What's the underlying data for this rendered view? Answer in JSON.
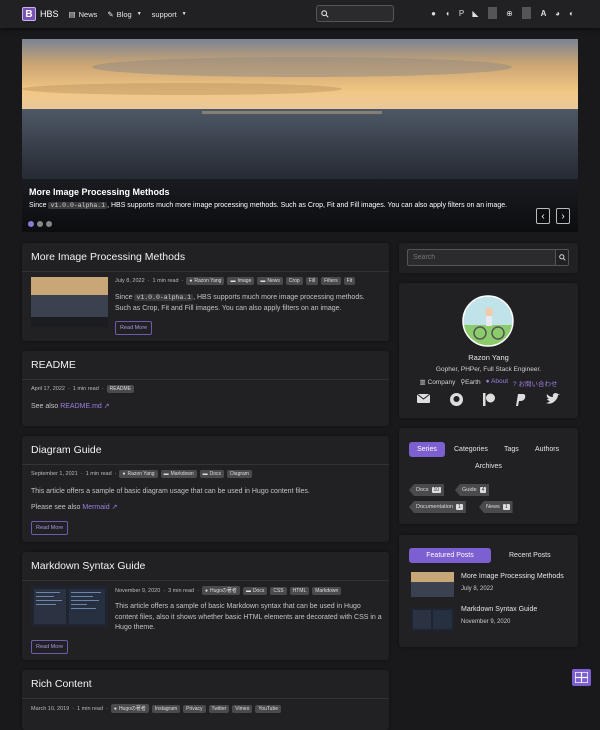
{
  "nav": {
    "brand": "HBS",
    "links": [
      {
        "label": "News",
        "icon": "newspaper-icon"
      },
      {
        "label": "Blog",
        "icon": "blog-icon"
      },
      {
        "label": "support",
        "icon": ""
      }
    ],
    "icons": [
      "github-icon",
      "patreon-icon",
      "paypal-icon",
      "rss-icon",
      "language-icon",
      "font-size-icon",
      "palette-icon",
      "theme-toggle-icon"
    ]
  },
  "hero": {
    "title": "More Image Processing Methods",
    "text_before": "Since ",
    "code": "v1.0.0-alpha.1",
    "text_after": ", HBS supports much more image processing methods. Such as Crop, Fit and Fill images. You can also apply filters on an image.",
    "slides": 3,
    "active": 0,
    "prev": "‹",
    "next": "›"
  },
  "posts": [
    {
      "title": "More Image Processing Methods",
      "date": "July 8, 2022",
      "read": "1 min read",
      "author": "Razon Yang",
      "tags": [
        "Image",
        "News",
        "Crop",
        "Fill",
        "Filters",
        "Fit"
      ],
      "excerpt_before": "Since ",
      "code": "v1.0.0-alpha.1",
      "excerpt_after": ", HBS supports much more image processing methods. Such as Crop, Fit and Fill images. You can also apply filters on an image.",
      "readmore": "Read More"
    },
    {
      "title": "README",
      "date": "April 17, 2022",
      "read": "1 min read",
      "tags": [
        "README"
      ],
      "see_also": "See also ",
      "link": "README.md"
    },
    {
      "title": "Diagram Guide",
      "date": "September 1, 2021",
      "read": "1 min read",
      "author": "Razon Yang",
      "tags": [
        "Markdown",
        "Docs",
        "Diagram"
      ],
      "excerpt": "This article offers a sample of basic diagram usage that can be used in Hugo content files.",
      "see_also": "Please see also ",
      "link": "Mermaid",
      "readmore": "Read More"
    },
    {
      "title": "Markdown Syntax Guide",
      "date": "November 9, 2020",
      "read": "3 min read",
      "author": "Hugoの著者",
      "tags": [
        "Docs",
        "CSS",
        "HTML",
        "Markdown"
      ],
      "excerpt": "This article offers a sample of basic Markdown syntax that can be used in Hugo content files, also it shows whether basic HTML elements are decorated with CSS in a Hugo theme.",
      "readmore": "Read More"
    },
    {
      "title": "Rich Content",
      "date": "March 10, 2019",
      "read": "1 min read",
      "author": "Hugoの著者",
      "tags": [
        "Instagram",
        "Privacy",
        "Twitter",
        "Vimeo",
        "YouTube"
      ]
    }
  ],
  "sidebar": {
    "search_placeholder": "Search",
    "profile": {
      "name": "Razon Yang",
      "bio": "Gopher, PHPer, Full Stack Engineer.",
      "company": "Company",
      "location": "Earth",
      "about": "About",
      "contact": "お問い合わせ"
    },
    "taxonomy_tabs": [
      "Series",
      "Categories",
      "Tags",
      "Authors",
      "Archives"
    ],
    "series": [
      {
        "label": "Docs",
        "count": "10"
      },
      {
        "label": "Guide",
        "count": "4"
      },
      {
        "label": "Documentation",
        "count": "1"
      },
      {
        "label": "News",
        "count": "1"
      }
    ],
    "post_tabs": [
      "Featured Posts",
      "Recent Posts"
    ],
    "featured": [
      {
        "title": "More Image Processing Methods",
        "date": "July 8, 2022"
      },
      {
        "title": "Markdown Syntax Guide",
        "date": "November 9, 2020"
      }
    ]
  }
}
